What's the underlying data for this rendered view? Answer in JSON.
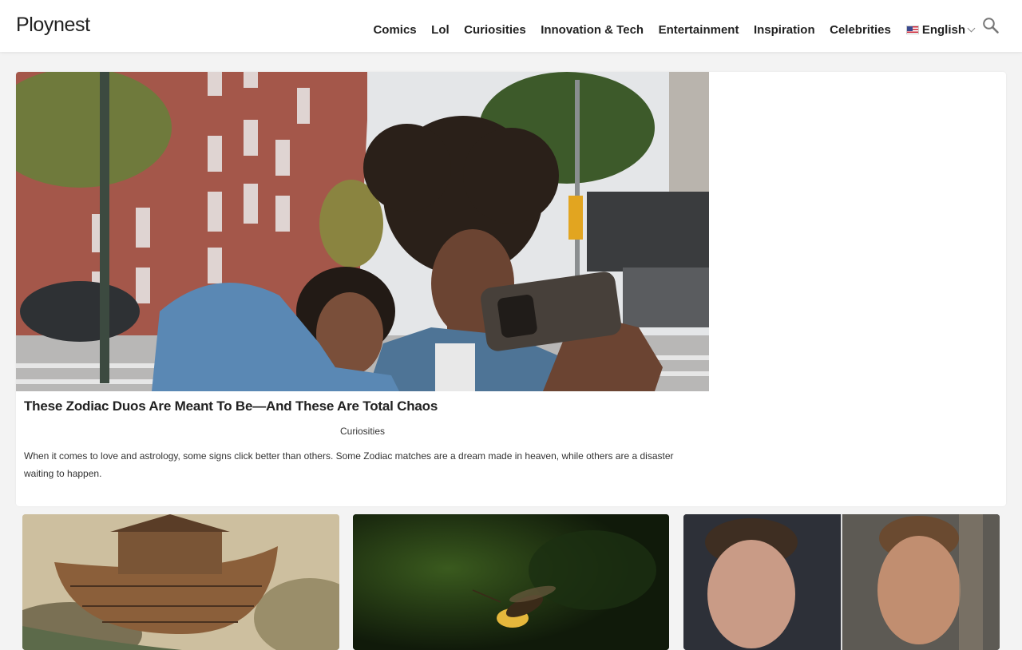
{
  "site": {
    "logo": "Ploynest"
  },
  "nav": {
    "items": [
      "Comics",
      "Lol",
      "Curiosities",
      "Innovation & Tech",
      "Entertainment",
      "Inspiration",
      "Celebrities"
    ],
    "language": "English"
  },
  "icons": {
    "search": "search-icon",
    "language_flag": "us-flag-icon",
    "language_chevron": "chevron-down-icon"
  },
  "featured": {
    "title": "These Zodiac Duos Are Meant To Be—And These Are Total Chaos",
    "category": "Curiosities",
    "excerpt": "When it comes to love and astrology, some signs click better than others. Some Zodiac matches are a dream made in heaven, while others are a disaster waiting to happen."
  },
  "colors": {
    "header_bg": "#ffffff",
    "page_bg": "#f3f3f3",
    "text": "#222222"
  }
}
